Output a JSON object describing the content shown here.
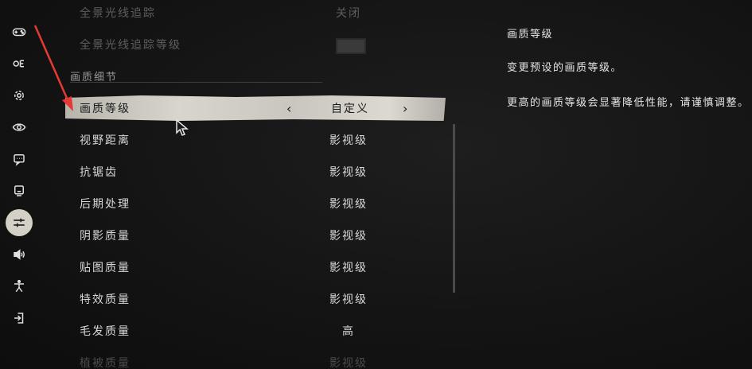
{
  "sidebar": {
    "items": [
      {
        "icon": "gamepad-icon",
        "active": false
      },
      {
        "icon": "subtitles-icon",
        "active": false
      },
      {
        "icon": "gear-icon",
        "active": false
      },
      {
        "icon": "eye-icon",
        "active": false
      },
      {
        "icon": "chat-icon",
        "active": false
      },
      {
        "icon": "monitor-icon",
        "active": false
      },
      {
        "icon": "sliders-icon",
        "active": true
      },
      {
        "icon": "audio-icon",
        "active": false
      },
      {
        "icon": "accessibility-icon",
        "active": false
      },
      {
        "icon": "exit-icon",
        "active": false
      }
    ]
  },
  "settings": {
    "top_rows": [
      {
        "label": "全景光线追踪",
        "value": "关闭"
      },
      {
        "label": "全景光线追踪等级",
        "value": ""
      }
    ],
    "section_title": "画质细节",
    "selected": {
      "label": "画质等级",
      "value": "自定义",
      "prev": "‹",
      "next": "›"
    },
    "rows": [
      {
        "label": "视野距离",
        "value": "影视级"
      },
      {
        "label": "抗锯齿",
        "value": "影视级"
      },
      {
        "label": "后期处理",
        "value": "影视级"
      },
      {
        "label": "阴影质量",
        "value": "影视级"
      },
      {
        "label": "贴图质量",
        "value": "影视级"
      },
      {
        "label": "特效质量",
        "value": "影视级"
      },
      {
        "label": "毛发质量",
        "value": "高"
      },
      {
        "label": "植被质量",
        "value": "影视级"
      }
    ]
  },
  "description": {
    "title": "画质等级",
    "line1": "变更预设的画质等级。",
    "line2": "更高的画质等级会显著降低性能，请谨慎调整。"
  },
  "colors": {
    "annotation_arrow": "#e53935",
    "selected_bg": "#cfccc4"
  }
}
